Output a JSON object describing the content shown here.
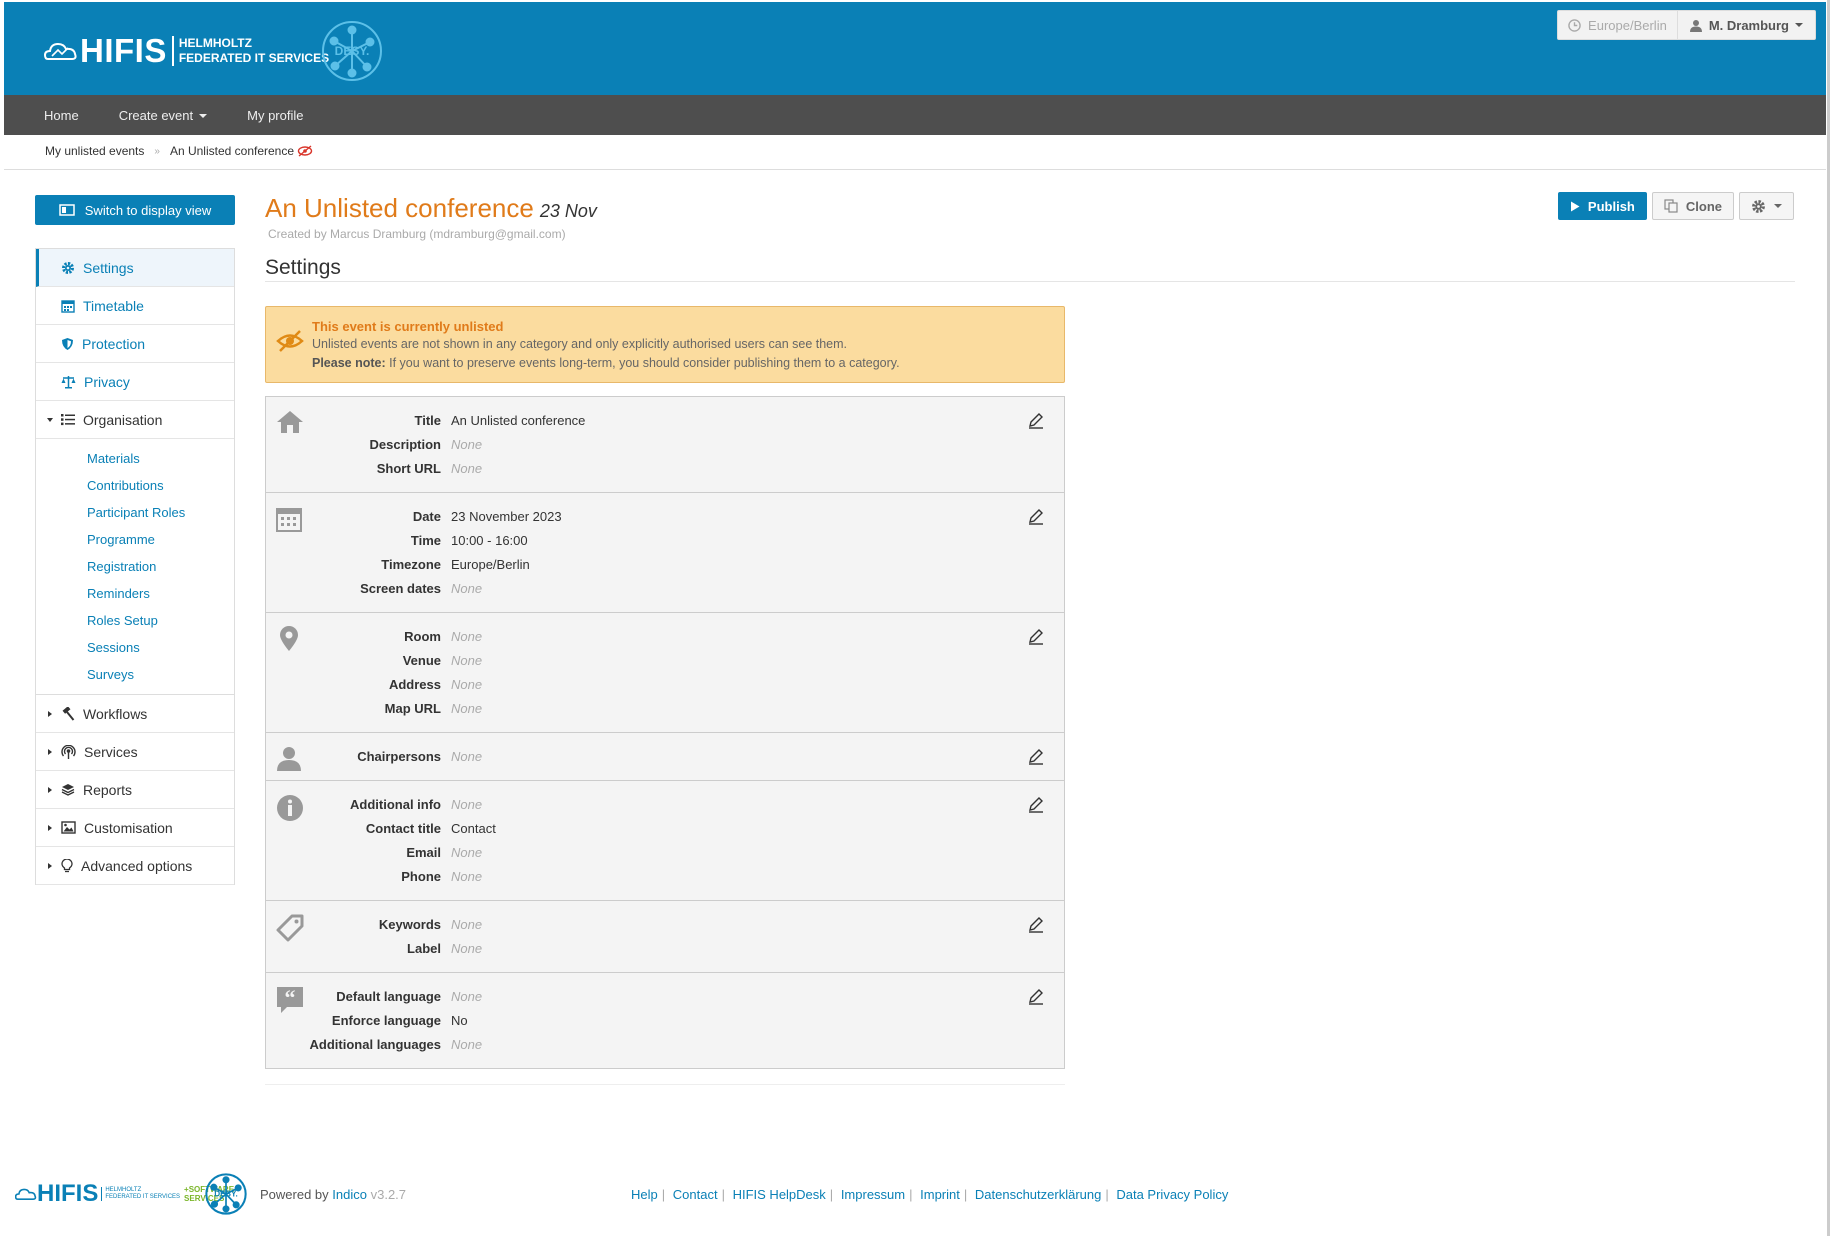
{
  "header": {
    "brand_word": "HIFIS",
    "brand_line1": "HELMHOLTZ",
    "brand_line2": "FEDERATED IT SERVICES",
    "desy_label": "DESY.",
    "timezone": "Europe/Berlin",
    "user": "M. Dramburg",
    "accent": "#0a80b6"
  },
  "menu": {
    "home": "Home",
    "create_event": "Create event",
    "my_profile": "My profile"
  },
  "breadcrumb": {
    "parent": "My unlisted events",
    "current": "An Unlisted conference"
  },
  "sidebar": {
    "switch_label": "Switch to display view",
    "items": [
      {
        "label": "Settings",
        "icon": "gear-icon"
      },
      {
        "label": "Timetable",
        "icon": "calendar-icon"
      },
      {
        "label": "Protection",
        "icon": "shield-icon"
      },
      {
        "label": "Privacy",
        "icon": "scale-icon"
      },
      {
        "label": "Organisation",
        "icon": "list-icon"
      },
      {
        "label": "Workflows",
        "icon": "hammer-icon"
      },
      {
        "label": "Services",
        "icon": "broadcast-icon"
      },
      {
        "label": "Reports",
        "icon": "stack-icon"
      },
      {
        "label": "Customisation",
        "icon": "image-icon"
      },
      {
        "label": "Advanced options",
        "icon": "bulb-icon"
      }
    ],
    "organisation_sub": [
      "Materials",
      "Contributions",
      "Participant Roles",
      "Programme",
      "Registration",
      "Reminders",
      "Roles Setup",
      "Sessions",
      "Surveys"
    ]
  },
  "event": {
    "title": "An Unlisted conference",
    "date": "23 Nov",
    "created_by": "Created by Marcus Dramburg (mdramburg@gmail.com)",
    "page_heading": "Settings"
  },
  "actions": {
    "publish": "Publish",
    "clone": "Clone"
  },
  "alert": {
    "title": "This event is currently unlisted",
    "line1": "Unlisted events are not shown in any category and only explicitly authorised users can see them.",
    "note_label": "Please note:",
    "note_text": "If you want to preserve events long-term, you should consider publishing them to a category."
  },
  "sections": [
    {
      "icon": "home-icon",
      "rows": [
        [
          "Title",
          "An Unlisted conference"
        ],
        [
          "Description",
          "None"
        ],
        [
          "Short URL",
          "None"
        ]
      ]
    },
    {
      "icon": "calendar-icon",
      "rows": [
        [
          "Date",
          "23 November 2023"
        ],
        [
          "Time",
          "10:00 - 16:00"
        ],
        [
          "Timezone",
          "Europe/Berlin"
        ],
        [
          "Screen dates",
          "None"
        ]
      ]
    },
    {
      "icon": "location-pin-icon",
      "rows": [
        [
          "Room",
          "None"
        ],
        [
          "Venue",
          "None"
        ],
        [
          "Address",
          "None"
        ],
        [
          "Map URL",
          "None"
        ]
      ]
    },
    {
      "icon": "user-icon",
      "rows": [
        [
          "Chairpersons",
          "None"
        ]
      ]
    },
    {
      "icon": "info-icon",
      "rows": [
        [
          "Additional info",
          "None"
        ],
        [
          "Contact title",
          "Contact"
        ],
        [
          "Email",
          "None"
        ],
        [
          "Phone",
          "None"
        ]
      ]
    },
    {
      "icon": "tag-icon",
      "rows": [
        [
          "Keywords",
          "None"
        ],
        [
          "Label",
          "None"
        ]
      ]
    },
    {
      "icon": "quote-icon",
      "rows": [
        [
          "Default language",
          "None"
        ],
        [
          "Enforce language",
          "No"
        ],
        [
          "Additional languages",
          "None"
        ]
      ]
    }
  ],
  "footer": {
    "brand_word": "HIFIS",
    "software_line1": "+SOFTWARE",
    "software_line2": "SERVICES",
    "powered_by": "Powered by",
    "indico": "Indico",
    "version": "v3.2.7",
    "links": [
      "Help",
      "Contact",
      "HIFIS HelpDesk",
      "Impressum",
      "Imprint",
      "Datenschutzerklärung",
      "Data Privacy Policy"
    ]
  }
}
